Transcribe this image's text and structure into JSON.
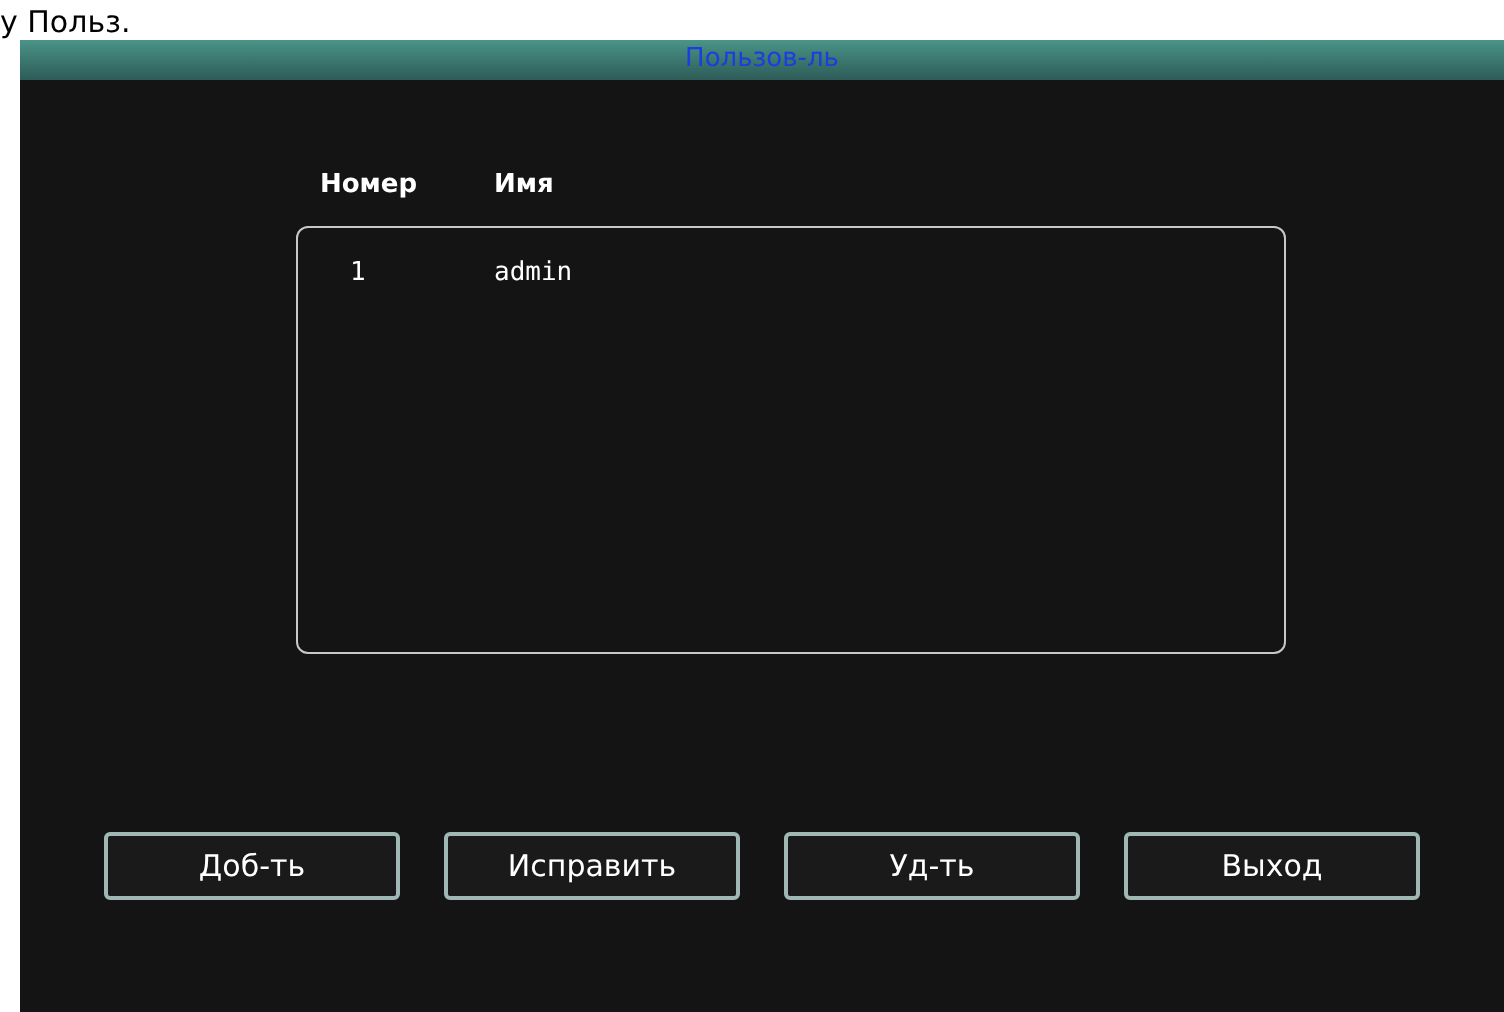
{
  "caption": "у Польз.",
  "window": {
    "title": "Пользов-ль"
  },
  "table": {
    "columns": [
      "Номер",
      "Имя"
    ],
    "rows": [
      {
        "number": "1",
        "name": "admin"
      }
    ]
  },
  "buttons": [
    "Доб-ть",
    "Исправить",
    "Уд-ть",
    "Выход"
  ]
}
